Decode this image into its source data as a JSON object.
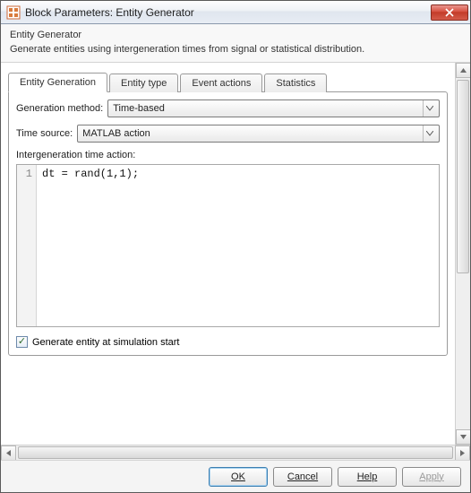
{
  "window": {
    "title": "Block Parameters: Entity Generator"
  },
  "description": {
    "heading": "Entity Generator",
    "text": "Generate entities using intergeneration times from signal or statistical distribution."
  },
  "tabs": [
    {
      "label": "Entity Generation"
    },
    {
      "label": "Entity type"
    },
    {
      "label": "Event actions"
    },
    {
      "label": "Statistics"
    }
  ],
  "fields": {
    "generation_method": {
      "label": "Generation method:",
      "value": "Time-based"
    },
    "time_source": {
      "label": "Time source:",
      "value": "MATLAB action"
    },
    "intergen_label": "Intergeneration time action:",
    "code_line_no": "1",
    "code_text": "dt = rand(1,1);",
    "generate_at_start": {
      "label": "Generate entity at simulation start",
      "checked": true
    }
  },
  "buttons": {
    "ok": "OK",
    "cancel": "Cancel",
    "help": "Help",
    "apply": "Apply"
  }
}
